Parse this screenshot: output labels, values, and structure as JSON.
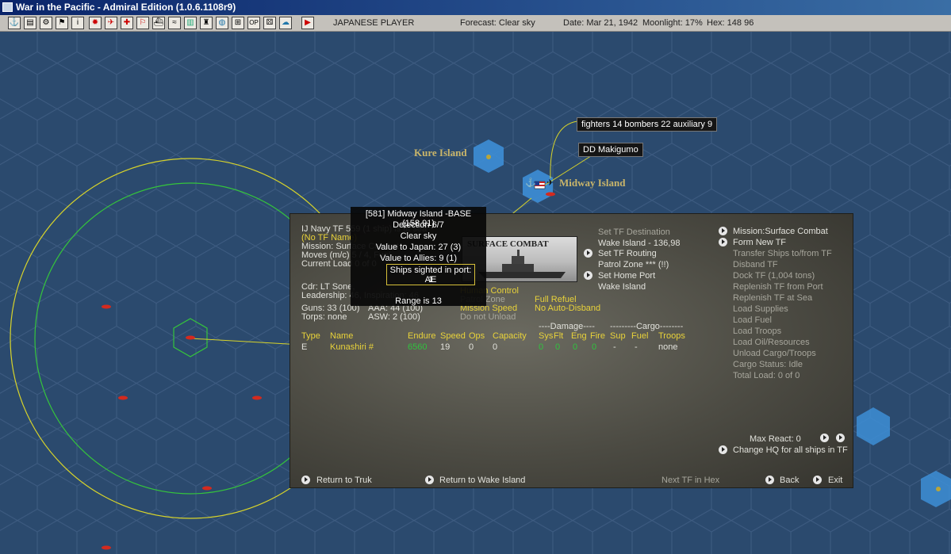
{
  "window": {
    "title": "War in the Pacific - Admiral Edition (1.0.6.1108r9)"
  },
  "toolbar": {
    "player": "JAPANESE PLAYER",
    "forecast": "Forecast: Clear sky",
    "date": "Date: Mar 21, 1942",
    "moonlight": "Moonlight: 17%",
    "hex": "Hex: 148 96",
    "buttons": [
      "anchor-icon",
      "document-icon",
      "gear-icon",
      "flag-icon",
      "info-icon",
      "rising-sun-icon",
      "plane-icon",
      "ground-unit-icon",
      "flag-red-icon",
      "ship-icon",
      "wave-icon",
      "chart-icon",
      "factory-icon",
      "globe-icon",
      "map-icon",
      "ops-icon",
      "dice-icon",
      "cloud-icon",
      "end-turn-icon"
    ]
  },
  "map": {
    "labels": {
      "kure": "Kure Island",
      "midway": "Midway Island"
    },
    "popups": {
      "aircraft": "fighters 14  bombers 22  auxiliary 9",
      "ship": "DD Makigumo"
    }
  },
  "tooltip": {
    "base": "[581] Midway Island -BASE (158,91)",
    "detection": "Detection 6/7",
    "weather": "Clear sky",
    "value_japan": "Value to Japan: 27 (3)",
    "value_allies": "Value to Allies: 9 (1)",
    "ships_sighted": "Ships sighted in port: 1",
    "ships_type": "AE",
    "range": "Range is 13"
  },
  "panel": {
    "tf_title": "IJ Navy TF 559 (1 ship) is at sea",
    "tf_name": "(No TF Name)",
    "mission": "Mission: Surface Combat",
    "moves": "Moves (m/c) 5 / 4, Fuel",
    "current_load": "Current Load 0 of 0",
    "commander": "Cdr: LT Sone,",
    "leadership": "Leadership: 46, Inspiration: 46",
    "guns": "Guns: 33 (100)",
    "aaa": "AAA: 44 (100)",
    "torps": "Torps: none",
    "asw": "ASW: 2 (100)",
    "image_caption": "SURFACE COMBAT",
    "human_control": "Human Control",
    "patrol_zone": "Patrol Zone",
    "mission_speed": "Mission Speed",
    "do_not_unload": "Do not Unload",
    "full_refuel": "Full Refuel",
    "no_auto_disband": "No Auto-Disband",
    "dest_heading": "Set TF Destination",
    "dest_value": "Wake Island - 136,98",
    "routing": "Set TF Routing",
    "patrol_value": "Patrol Zone *** (!!)",
    "home_port": "Set Home Port",
    "home_value": "Wake Island",
    "damage_header": "----Damage----",
    "cargo_header": "---------Cargo--------",
    "columns": [
      "Type",
      "Name",
      "Endure",
      "Speed",
      "Ops",
      "Capacity",
      "Sys",
      "Flt",
      "Eng",
      "Fire",
      "Sup",
      "Fuel",
      "Troops"
    ],
    "ship_row": {
      "type": "E",
      "name": "Kunashiri #",
      "endure": "6560",
      "speed": "19",
      "ops": "0",
      "capacity": "0",
      "sys": "0",
      "flt": "0",
      "eng": "0",
      "fire": "0",
      "sup": "-",
      "fuel": "-",
      "troops": "none"
    },
    "right_menu": {
      "mission": "Mission:Surface Combat",
      "form_new": "Form New TF",
      "transfer": "Transfer Ships to/from TF",
      "disband": "Disband TF",
      "dock": "Dock TF (1,004 tons)",
      "replenish_port": "Replenish TF from Port",
      "replenish_sea": "Replenish TF at Sea",
      "load_supplies": "Load Supplies",
      "load_fuel": "Load Fuel",
      "load_troops": "Load Troops",
      "load_oil": "Load Oil/Resources",
      "unload": "Unload Cargo/Troops",
      "cargo_status": "Cargo Status: Idle",
      "total_load": "Total Load: 0 of 0"
    },
    "max_react": "Max React: 0",
    "change_hq": "Change HQ for all ships in TF",
    "return_truk": "Return to Truk",
    "return_wake": "Return to Wake Island",
    "next_tf": "Next TF in Hex",
    "back": "Back",
    "exit": "Exit"
  }
}
